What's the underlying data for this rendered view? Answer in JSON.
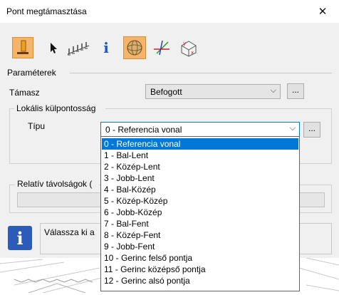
{
  "window": {
    "title": "Pont megtámasztása",
    "close_glyph": "✕"
  },
  "toolbar": {
    "icons": [
      {
        "name": "support-point-icon",
        "active": true
      },
      {
        "name": "pointer-icon",
        "active": false
      },
      {
        "name": "multi-support-icon",
        "active": false
      },
      {
        "name": "info-icon",
        "active": false,
        "glyph": "i"
      },
      {
        "name": "sphere-icon",
        "active": true
      },
      {
        "name": "axes-icon",
        "active": false
      },
      {
        "name": "local-coordinate-icon",
        "active": false
      }
    ]
  },
  "parameters": {
    "heading": "Paraméterek"
  },
  "support": {
    "label": "Támasz",
    "value": "Befogott",
    "button_label": "..."
  },
  "eccentricity": {
    "heading": "Lokális külpontosság",
    "type_label": "Típu",
    "type_value": "0 - Referencia vonal",
    "button_label": "..."
  },
  "relative": {
    "label": "Relatív távolságok ("
  },
  "info": {
    "icon_glyph": "i",
    "text": "Válassza ki a"
  },
  "dropdown": {
    "options": [
      "0 - Referencia vonal",
      "1 - Bal-Lent",
      "2 - Közép-Lent",
      "3 - Jobb-Lent",
      "4 - Bal-Közép",
      "5 - Közép-Közép",
      "6 - Jobb-Közép",
      "7 - Bal-Fent",
      "8 - Közép-Fent",
      "9 - Jobb-Fent",
      "10 - Gerinc felső pontja",
      "11 - Gerinc középső pontja",
      "12 - Gerinc alsó pontja"
    ],
    "selected_index": 0
  },
  "colors": {
    "accent": "#0078d7",
    "active_tool": "#f6b46b",
    "info_icon_bg": "#2c5ab8"
  }
}
